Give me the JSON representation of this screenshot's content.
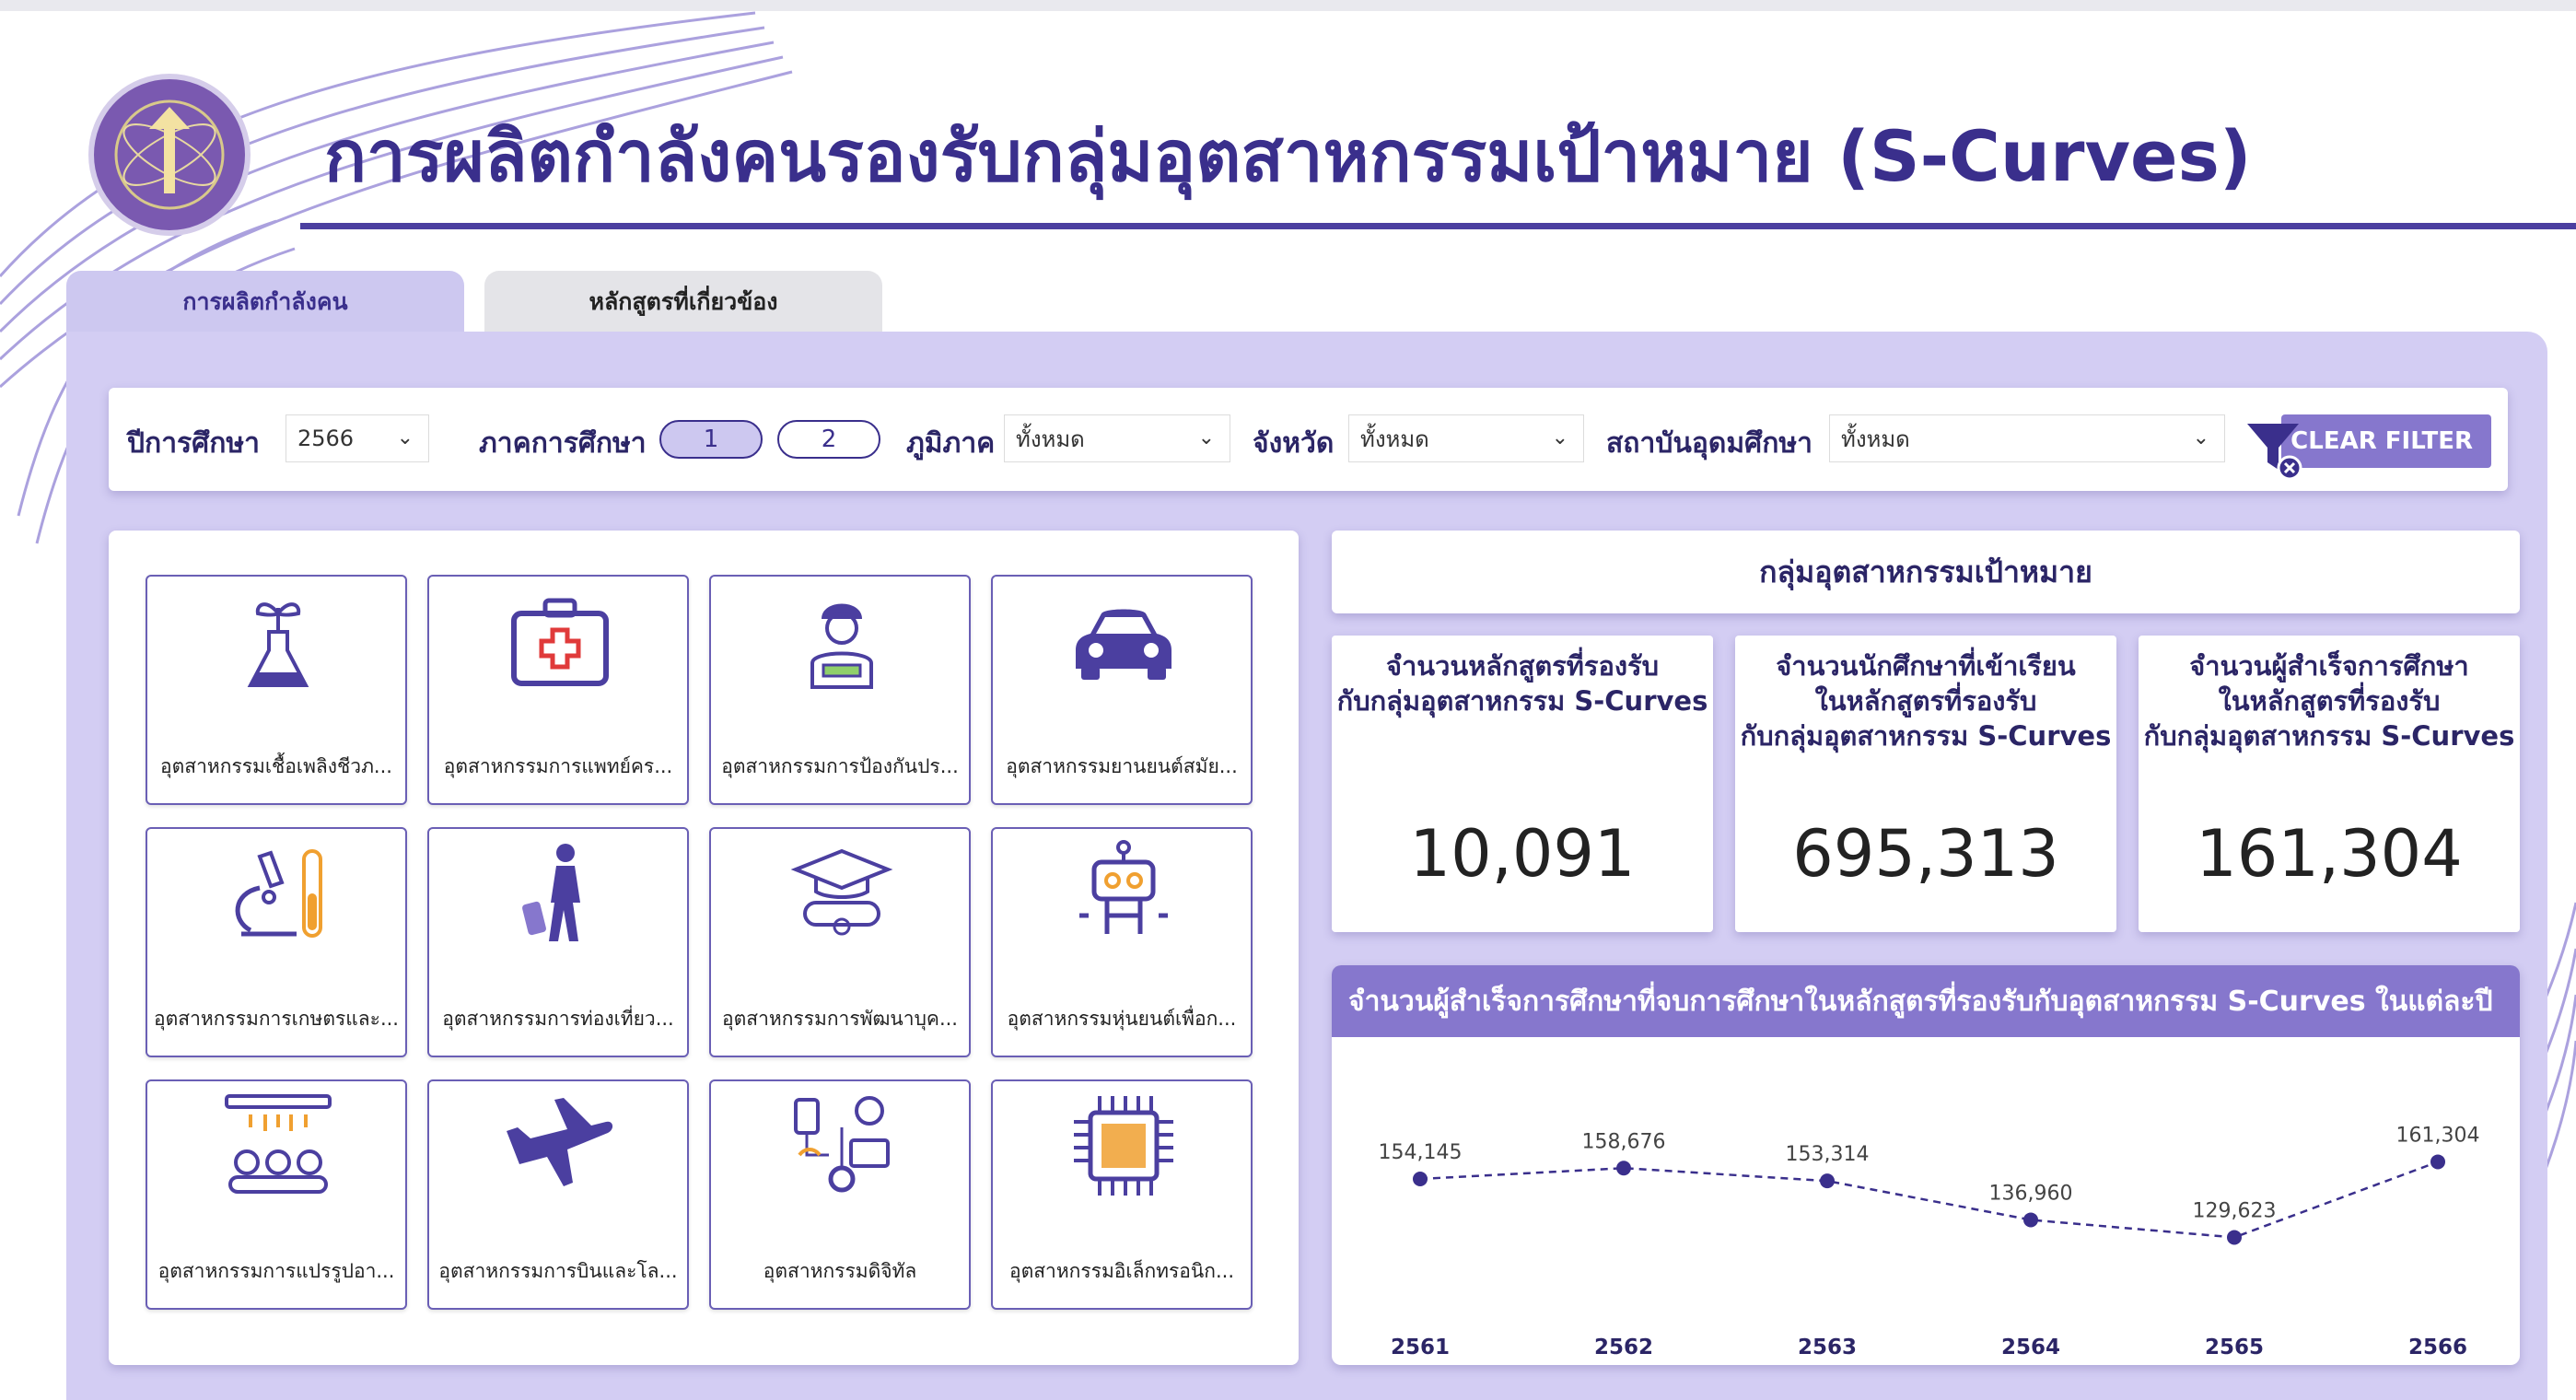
{
  "header": {
    "title": "การผลิตกำลังคนรองรับกลุ่มอุตสาหกรรมเป้าหมาย (S-Curves)"
  },
  "tabs": [
    {
      "label": "การผลิตกำลังคน",
      "active": true
    },
    {
      "label": "หลักสูตรที่เกี่ยวข้อง",
      "active": false
    }
  ],
  "filters": {
    "year_label": "ปีการศึกษา",
    "year_value": "2566",
    "semester_label": "ภาคการศึกษา",
    "semester_options": [
      "1",
      "2"
    ],
    "semester_selected": "1",
    "region_label": "ภูมิภาค",
    "region_value": "ทั้งหมด",
    "province_label": "จังหวัด",
    "province_value": "ทั้งหมด",
    "institution_label": "สถาบันอุดมศึกษา",
    "institution_value": "ทั้งหมด",
    "clear_label": "CLEAR FILTER"
  },
  "industries": [
    {
      "label": "อุตสาหกรรมเชื้อเพลิงชีวภ...",
      "icon": "plant-flask-icon"
    },
    {
      "label": "อุตสาหกรรมการแพทย์คร...",
      "icon": "first-aid-kit-icon"
    },
    {
      "label": "อุตสาหกรรมการป้องกันปร...",
      "icon": "soldier-icon"
    },
    {
      "label": "อุตสาหกรรมยานยนต์สมัย...",
      "icon": "car-icon"
    },
    {
      "label": "อุตสาหกรรมการเกษตรและ...",
      "icon": "microscope-icon"
    },
    {
      "label": "อุตสาหกรรมการท่องเที่ยว...",
      "icon": "traveler-icon"
    },
    {
      "label": "อุตสาหกรรมการพัฒนาบุค...",
      "icon": "graduation-icon"
    },
    {
      "label": "อุตสาหกรรมหุ่นยนต์เพื่อก...",
      "icon": "robot-icon"
    },
    {
      "label": "อุตสาหกรรมการแปรรูปอา...",
      "icon": "food-processing-icon"
    },
    {
      "label": "อุตสาหกรรมการบินและโล...",
      "icon": "airplane-icon"
    },
    {
      "label": "อุตสาหกรรมดิจิทัล",
      "icon": "digital-devices-icon"
    },
    {
      "label": "อุตสาหกรรมอิเล็กทรอนิก...",
      "icon": "chip-icon"
    }
  ],
  "summary": {
    "header": "กลุ่มอุตสาหกรรมเป้าหมาย",
    "kpis": [
      {
        "title": "จำนวนหลักสูตรที่รองรับ\nกับกลุ่มอุตสาหกรรม S-Curves",
        "value": "10,091"
      },
      {
        "title": "จำนวนนักศึกษาที่เข้าเรียน\nในหลักสูตรที่รองรับ\nกับกลุ่มอุตสาหกรรม S-Curves",
        "value": "695,313"
      },
      {
        "title": "จำนวนผู้สำเร็จการศึกษา\nในหลักสูตรที่รองรับ\nกับกลุ่มอุตสาหกรรม S-Curves",
        "value": "161,304"
      }
    ]
  },
  "colors": {
    "accent": "#8677cd",
    "panel": "#d3cdf3",
    "dark": "#2b2566",
    "icon": "#4b3fa0",
    "highlight": "#f0a030"
  },
  "chart_data": {
    "type": "line",
    "title": "จำนวนผู้สำเร็จการศึกษาที่จบการศึกษาในหลักสูตรที่รองรับกับอุตสาหกรรม S-Curves ในแต่ละปี",
    "x": [
      "2561",
      "2562",
      "2563",
      "2564",
      "2565",
      "2566"
    ],
    "values": [
      154145,
      158676,
      153314,
      136960,
      129623,
      161304
    ],
    "labels": [
      "154,145",
      "158,676",
      "153,314",
      "136,960",
      "129,623",
      "161,304"
    ],
    "line_style": "dashed",
    "ylim": [
      0,
      170000
    ]
  }
}
